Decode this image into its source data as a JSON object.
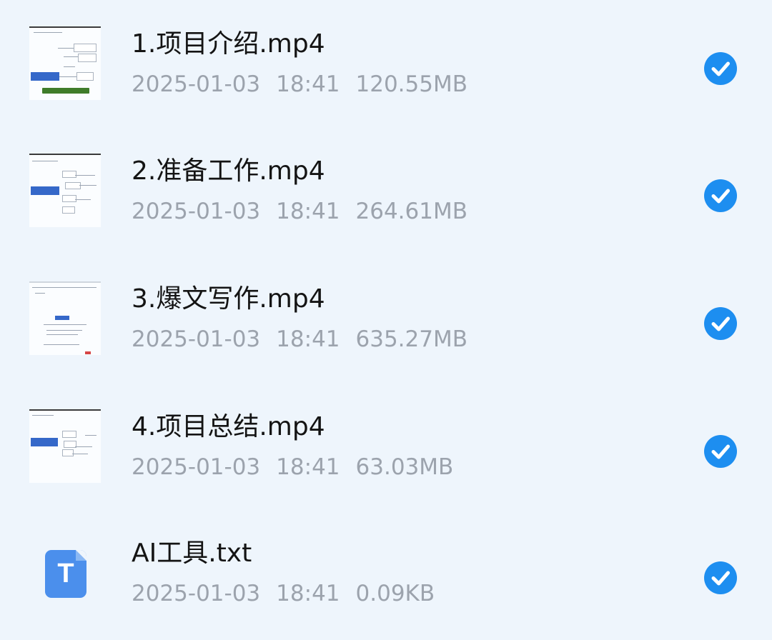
{
  "files": [
    {
      "name": "1.项目介绍.mp4",
      "date": "2025-01-03",
      "time": "18:41",
      "size": "120.55MB",
      "type": "video",
      "thumb_icon": "video-thumbnail-icon",
      "selected": true
    },
    {
      "name": "2.准备工作.mp4",
      "date": "2025-01-03",
      "time": "18:41",
      "size": "264.61MB",
      "type": "video",
      "thumb_icon": "video-thumbnail-icon",
      "selected": true
    },
    {
      "name": "3.爆文写作.mp4",
      "date": "2025-01-03",
      "time": "18:41",
      "size": "635.27MB",
      "type": "video",
      "thumb_icon": "video-thumbnail-icon",
      "selected": true
    },
    {
      "name": "4.项目总结.mp4",
      "date": "2025-01-03",
      "time": "18:41",
      "size": "63.03MB",
      "type": "video",
      "thumb_icon": "video-thumbnail-icon",
      "selected": true
    },
    {
      "name": "AI工具.txt",
      "date": "2025-01-03",
      "time": "18:41",
      "size": "0.09KB",
      "type": "text",
      "thumb_icon": "text-file-icon",
      "icon_letter": "T",
      "selected": true
    }
  ],
  "colors": {
    "background": "#eef5fc",
    "check_accent": "#1d8ef0",
    "txt_icon": "#4b8fec",
    "name_text": "#141414",
    "meta_text": "#9ca3ad"
  }
}
